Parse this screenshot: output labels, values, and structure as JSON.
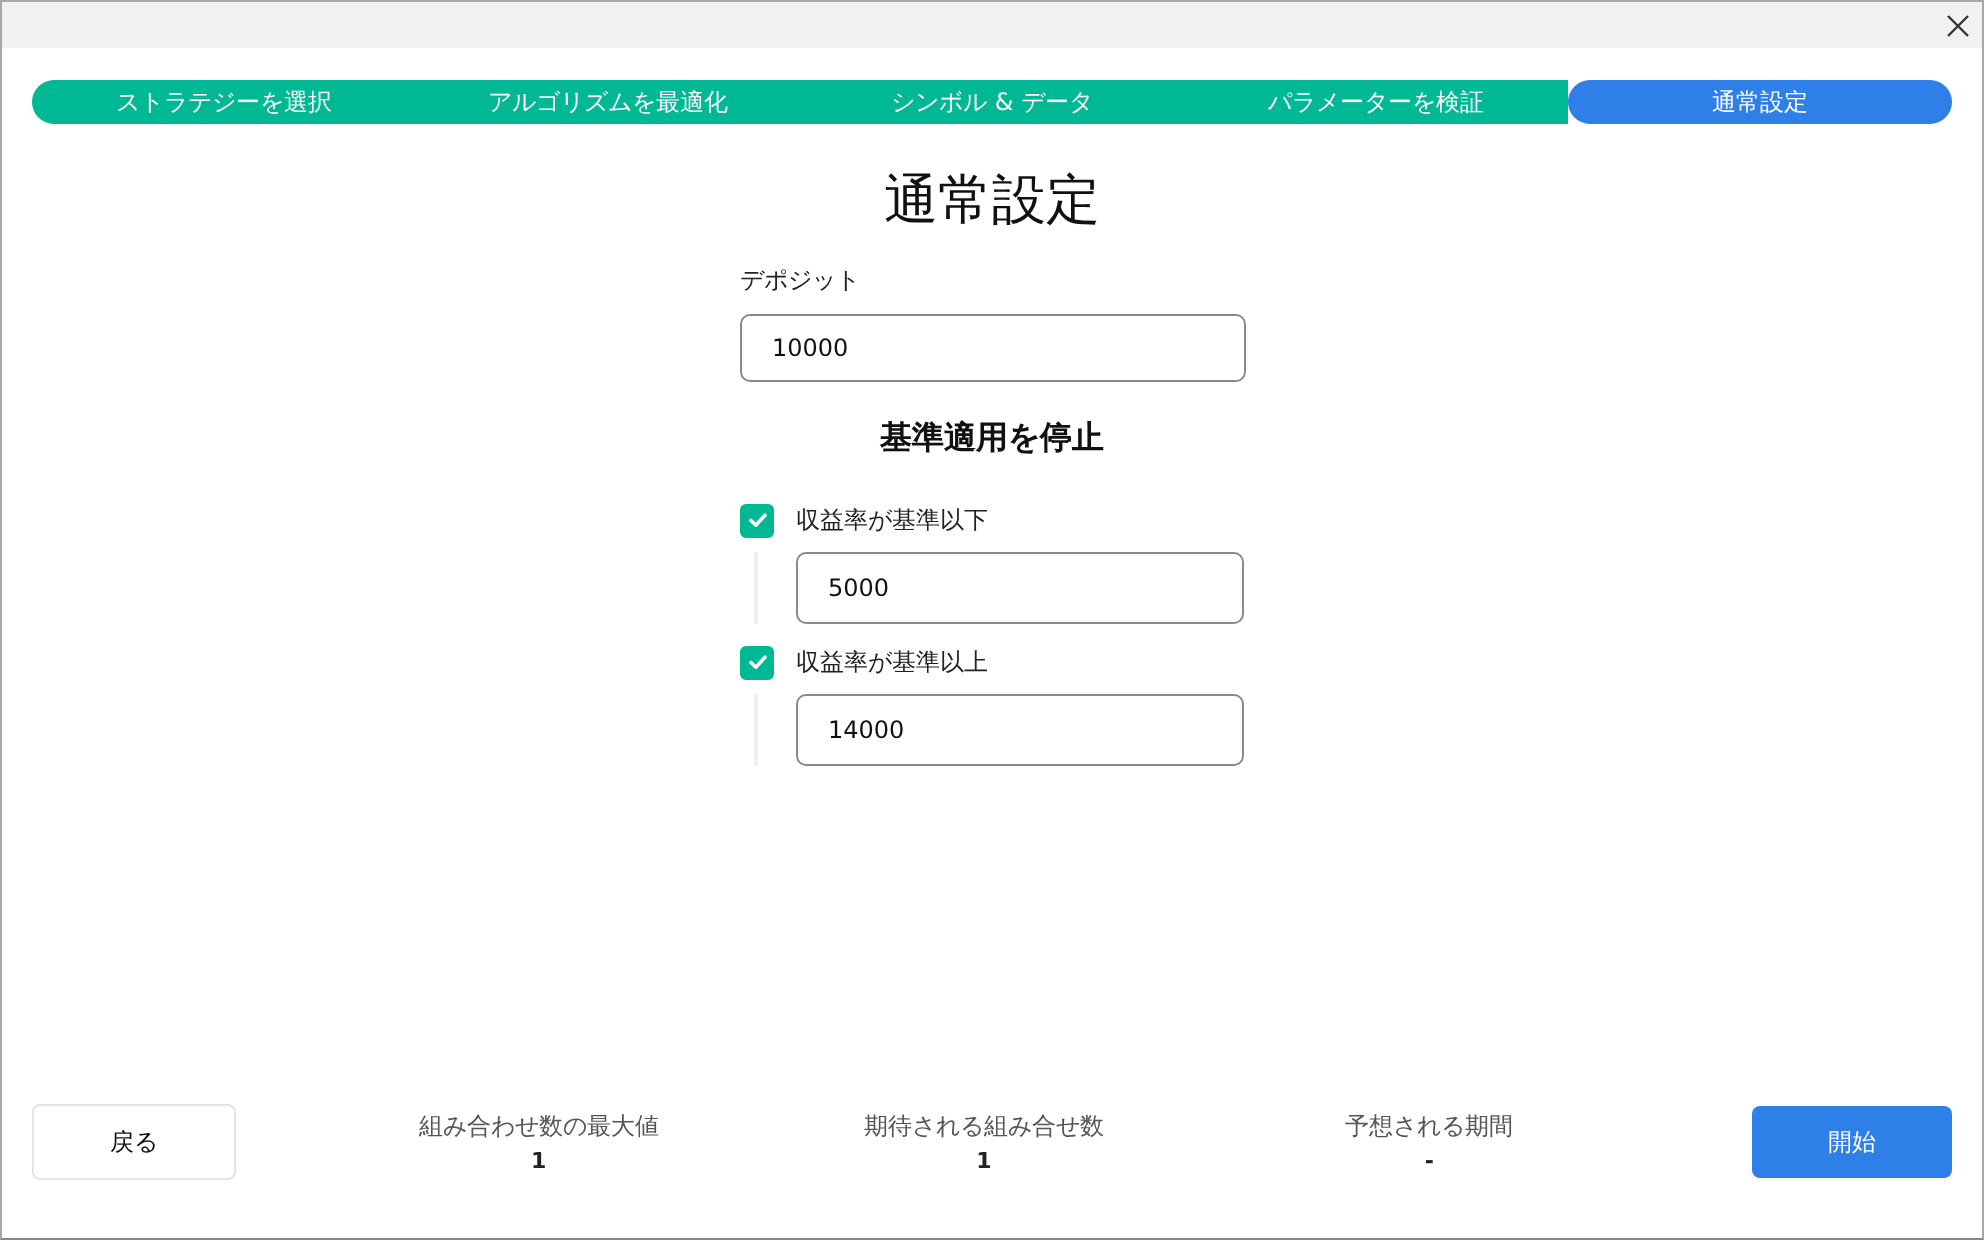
{
  "steps": [
    {
      "label": "ストラテジーを選択",
      "selected": false
    },
    {
      "label": "アルゴリズムを最適化",
      "selected": false
    },
    {
      "label": "シンボル & データ",
      "selected": false
    },
    {
      "label": "パラメーターを検証",
      "selected": false
    },
    {
      "label": "通常設定",
      "selected": true
    }
  ],
  "title": "通常設定",
  "deposit": {
    "label": "デポジット",
    "value": "10000"
  },
  "stop_section": {
    "heading": "基準適用を停止",
    "criteria": [
      {
        "label": "収益率が基準以下",
        "checked": true,
        "value": "5000"
      },
      {
        "label": "収益率が基準以上",
        "checked": true,
        "value": "14000"
      }
    ]
  },
  "footer": {
    "back_button": "戻る",
    "stats": [
      {
        "label": "組み合わせ数の最大値",
        "value": "1"
      },
      {
        "label": "期待される組み合せ数",
        "value": "1"
      },
      {
        "label": "予想される期間",
        "value": "-"
      }
    ],
    "start_button": "開始"
  }
}
